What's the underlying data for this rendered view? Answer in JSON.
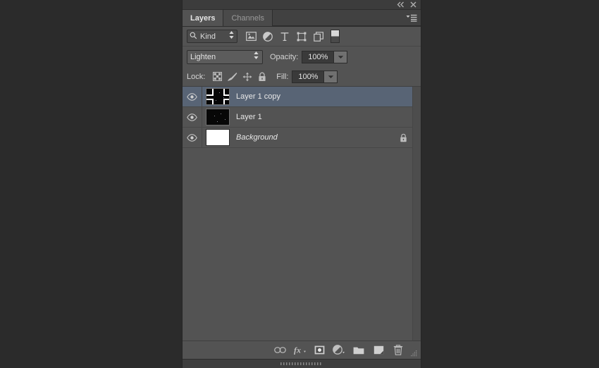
{
  "window": {
    "collapse_icon": "collapse-to-icons-icon",
    "close_icon": "close-icon"
  },
  "tabs": [
    {
      "label": "Layers",
      "active": true
    },
    {
      "label": "Channels",
      "active": false
    }
  ],
  "panel_menu": {
    "icon": "panel-menu-icon"
  },
  "filter": {
    "search_icon": "search-icon",
    "kind_label": "Kind",
    "stepper_icon": "updown-stepper-icon",
    "icons": [
      "filter-pixel-layers-icon",
      "filter-adjustment-layers-icon",
      "filter-type-layers-icon",
      "filter-shape-layers-icon",
      "filter-smart-object-icon"
    ],
    "toggle_name": "filter-enable-toggle"
  },
  "blend": {
    "mode": "Lighten",
    "mode_stepper_icon": "updown-stepper-icon",
    "opacity_label": "Opacity:",
    "opacity_value": "100%",
    "opacity_arrow_icon": "chevron-down-icon"
  },
  "lock": {
    "label": "Lock:",
    "icons": [
      "lock-transparent-pixels-icon",
      "lock-image-pixels-icon",
      "lock-position-icon",
      "lock-all-icon"
    ],
    "fill_label": "Fill:",
    "fill_value": "100%",
    "fill_arrow_icon": "chevron-down-icon"
  },
  "layers": [
    {
      "name": "Layer 1 copy",
      "visible": true,
      "selected": true,
      "italic": false,
      "thumb": "dark",
      "locked": false
    },
    {
      "name": "Layer 1",
      "visible": true,
      "selected": false,
      "italic": false,
      "thumb": "dark",
      "locked": false
    },
    {
      "name": "Background",
      "visible": true,
      "selected": false,
      "italic": true,
      "thumb": "white",
      "locked": true,
      "lock_icon": "lock-closed-icon"
    }
  ],
  "bottom_toolbar": [
    "link-layers-icon",
    "add-layer-style-icon",
    "add-layer-mask-icon",
    "new-adjustment-layer-icon",
    "new-group-icon",
    "new-layer-icon",
    "delete-layer-icon"
  ],
  "colors": {
    "panel_bg": "#535353",
    "header_bg": "#3c3c3c",
    "selection": "#586475",
    "outer_bg": "#2b2b2b",
    "text": "#e8e8e8"
  }
}
